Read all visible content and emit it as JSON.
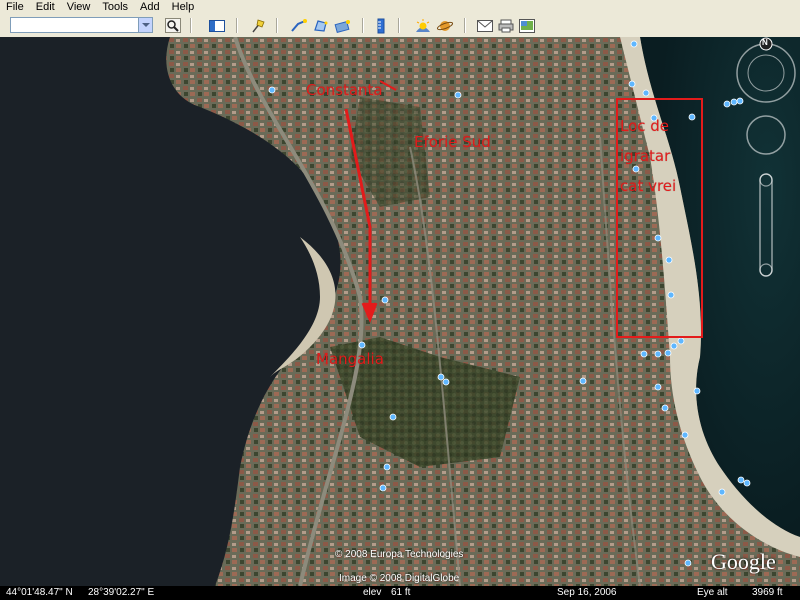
{
  "menu": [
    "File",
    "Edit",
    "View",
    "Tools",
    "Add",
    "Help"
  ],
  "toolbar": {
    "search_value": "",
    "icons": [
      "search-icon",
      "sidebar-icon",
      "placemark-icon",
      "path-icon",
      "polygon-icon",
      "overlay-icon",
      "ruler-icon",
      "sun-icon",
      "planet-icon",
      "email-icon",
      "print-icon",
      "image-icon"
    ]
  },
  "map": {
    "labels": {
      "constanta": "Constanta",
      "eforie_sud": "Eforie Sud",
      "mangalia": "Mangalia",
      "loc_de": "Loc de",
      "igratar": "igratar",
      "cat_vrei": "cat vrei"
    },
    "copyright": {
      "europa": "© 2008 Europa Technologies",
      "image": "Image © 2008 DigitalGlobe"
    },
    "logo": "Google",
    "compass_north": "N",
    "colors": {
      "annotation": "#e31b1b",
      "water_left": "#1b2127",
      "water_right": "#0e2a2e",
      "land": "#6b6f55",
      "beach": "#d9d4c2",
      "poi": "#5fb7ff"
    }
  },
  "status": {
    "lat": "44°01'48.47\" N",
    "lon": "28°39'02.27\" E",
    "elev_label": "elev",
    "elev_value": "61 ft",
    "date": "Sep 16, 2006",
    "eye_alt_label": "Eye alt",
    "eye_alt_value": "3969 ft"
  }
}
